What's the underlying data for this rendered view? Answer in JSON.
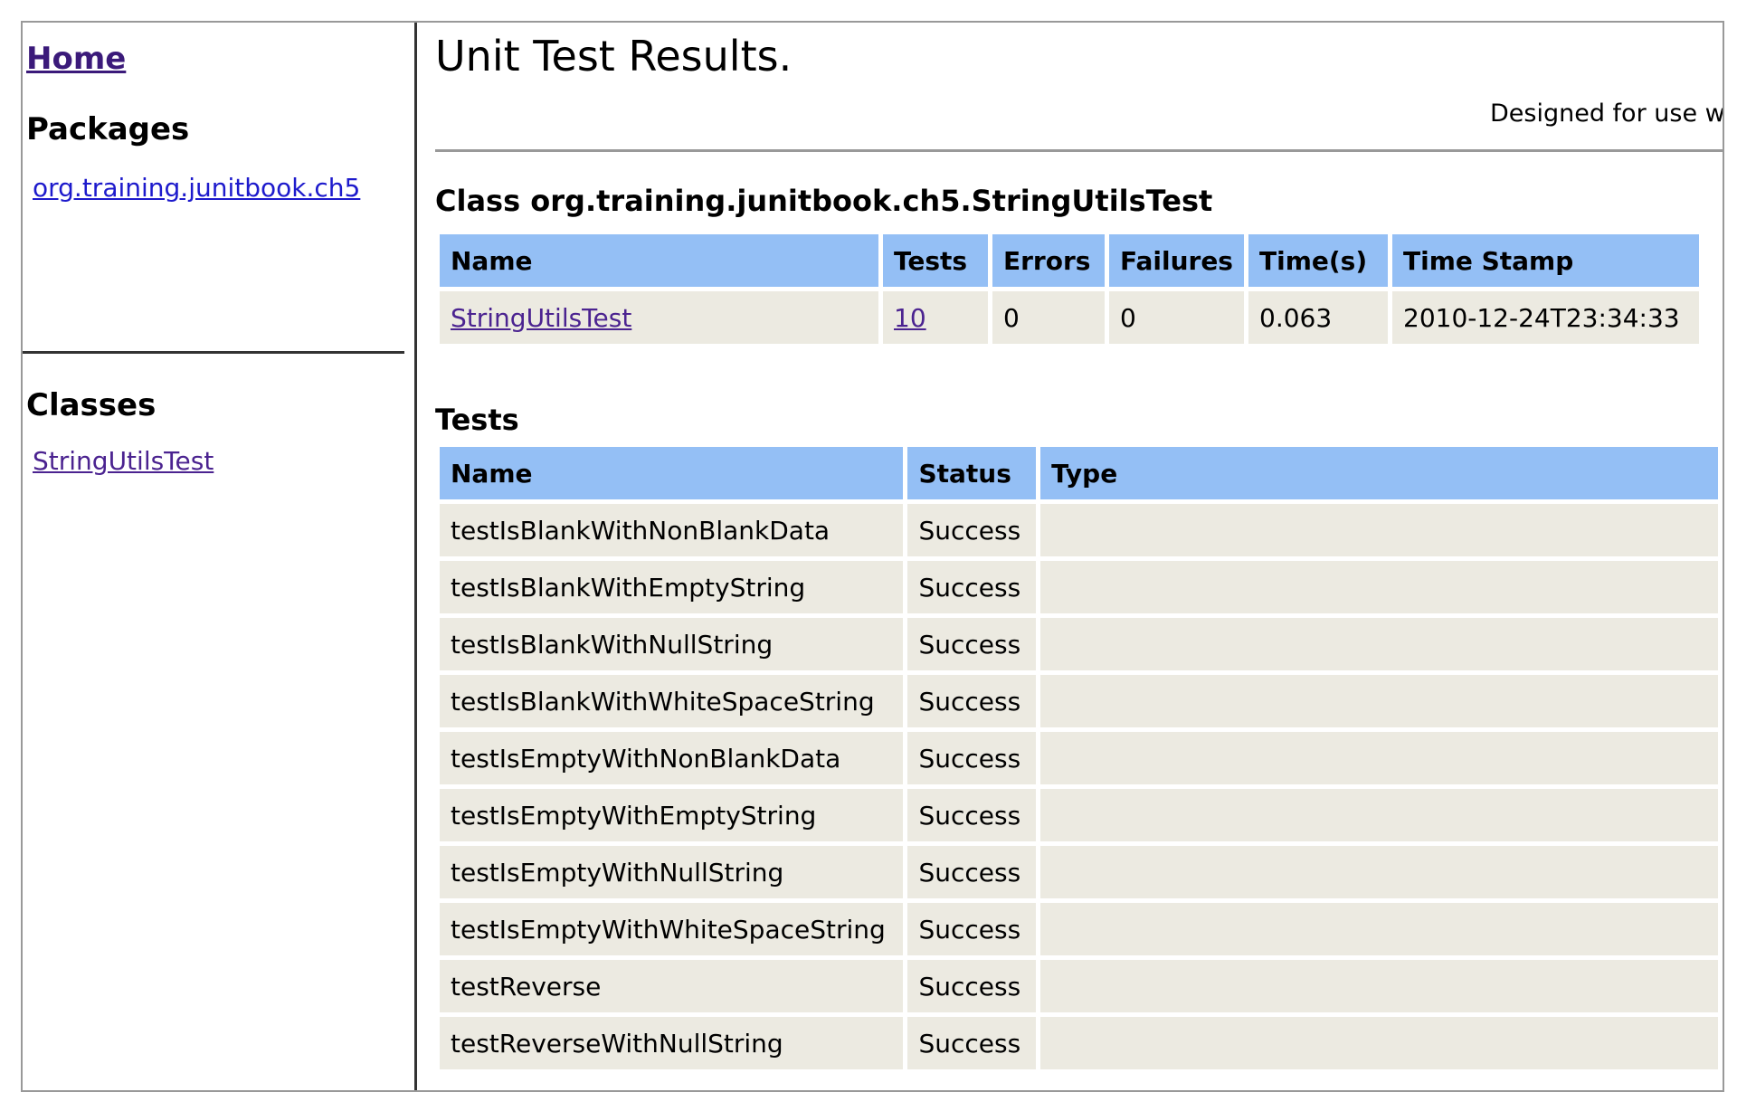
{
  "sidebar": {
    "home_label": "Home",
    "packages_heading": "Packages",
    "package_link": "org.training.junitbook.ch5",
    "classes_heading": "Classes",
    "class_link": "StringUtilsTest"
  },
  "main": {
    "title": "Unit Test Results.",
    "designed_text": "Designed for use w",
    "class_heading": "Class org.training.junitbook.ch5.StringUtilsTest",
    "class_table": {
      "headers": [
        "Name",
        "Tests",
        "Errors",
        "Failures",
        "Time(s)",
        "Time Stamp"
      ],
      "row": {
        "name": "StringUtilsTest",
        "tests": "10",
        "errors": "0",
        "failures": "0",
        "time": "0.063",
        "timestamp": "2010-12-24T23:34:33"
      }
    },
    "tests_heading": "Tests",
    "tests_table": {
      "headers": [
        "Name",
        "Status",
        "Type"
      ],
      "rows": [
        {
          "name": "testIsBlankWithNonBlankData",
          "status": "Success",
          "type": ""
        },
        {
          "name": "testIsBlankWithEmptyString",
          "status": "Success",
          "type": ""
        },
        {
          "name": "testIsBlankWithNullString",
          "status": "Success",
          "type": ""
        },
        {
          "name": "testIsBlankWithWhiteSpaceString",
          "status": "Success",
          "type": ""
        },
        {
          "name": "testIsEmptyWithNonBlankData",
          "status": "Success",
          "type": ""
        },
        {
          "name": "testIsEmptyWithEmptyString",
          "status": "Success",
          "type": ""
        },
        {
          "name": "testIsEmptyWithNullString",
          "status": "Success",
          "type": ""
        },
        {
          "name": "testIsEmptyWithWhiteSpaceString",
          "status": "Success",
          "type": ""
        },
        {
          "name": "testReverse",
          "status": "Success",
          "type": ""
        },
        {
          "name": "testReverseWithNullString",
          "status": "Success",
          "type": ""
        }
      ]
    }
  },
  "colors": {
    "header_bg": "#94bff5",
    "cell_bg": "#eceae1",
    "link": "#1d1acc",
    "visited_link": "#4b2390"
  }
}
